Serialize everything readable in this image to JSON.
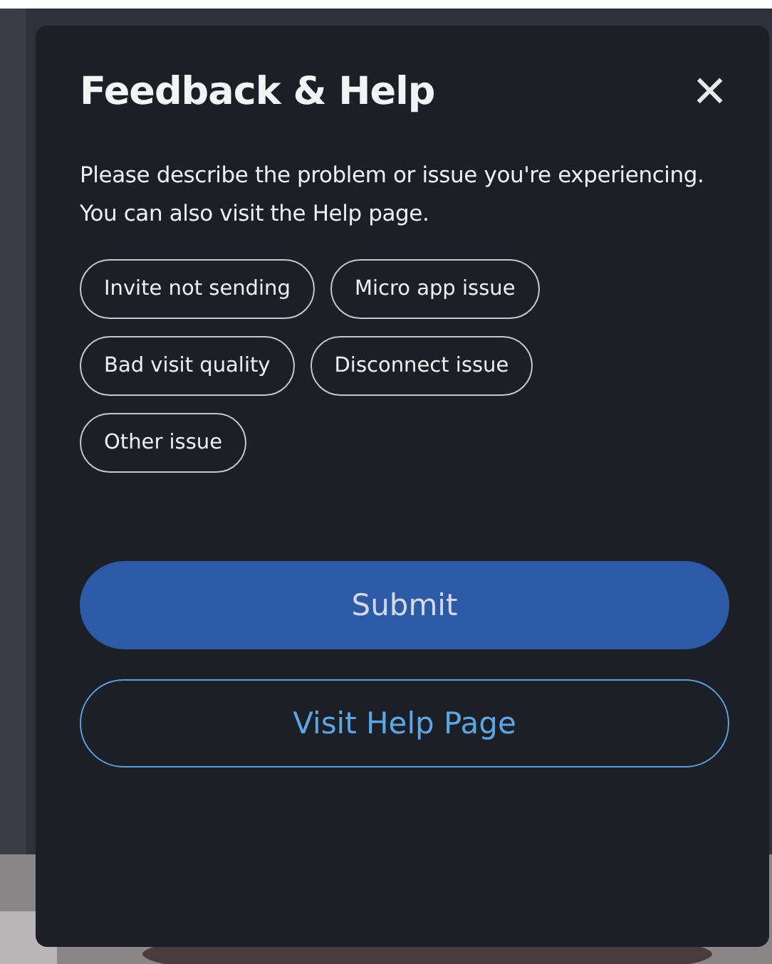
{
  "dialog": {
    "title": "Feedback & Help",
    "close_label": "×",
    "description": "Please describe the problem or issue you're experiencing. You can also visit the Help page."
  },
  "issues": [
    {
      "label": "Invite not sending",
      "selected": false
    },
    {
      "label": "Micro app issue",
      "selected": false
    },
    {
      "label": "Bad visit quality",
      "selected": false
    },
    {
      "label": "Disconnect issue",
      "selected": false
    },
    {
      "label": "Other issue",
      "selected": false
    }
  ],
  "buttons": [
    {
      "label": "Submit",
      "kind": "primary"
    },
    {
      "label": "Visit Help Page",
      "kind": "outline"
    }
  ]
}
